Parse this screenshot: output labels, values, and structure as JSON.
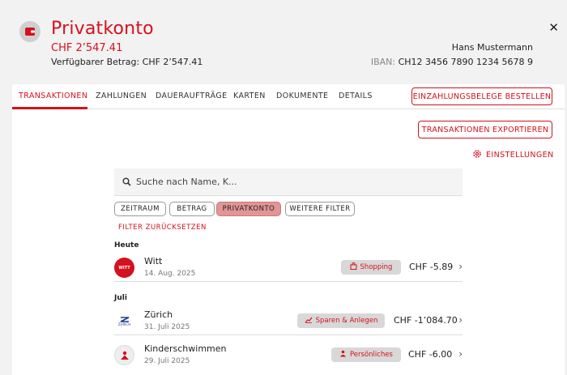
{
  "header": {
    "title": "Privatkonto",
    "balance": "CHF 2’547.41",
    "available": "Verfügbarer Betrag: CHF 2’547.41",
    "owner": "Hans Mustermann",
    "iban_label": "IBAN:",
    "iban_value": "CH12 3456 7890 1234 5678 9",
    "close_glyph": "✕"
  },
  "tabs": [
    {
      "label": "TRANSAKTIONEN",
      "active": true
    },
    {
      "label": "ZAHLUNGEN"
    },
    {
      "label": "DAUERAUFTRÄGE"
    },
    {
      "label": "KARTEN"
    },
    {
      "label": "DOKUMENTE"
    },
    {
      "label": "DETAILS"
    }
  ],
  "actions": {
    "order_slips": "EINZAHLUNGSBELEGE BESTELLEN",
    "export": "TRANSAKTIONEN EXPORTIEREN",
    "settings": "EINSTELLUNGEN"
  },
  "search": {
    "placeholder": "Suche nach Name, K..."
  },
  "filters": {
    "chips": [
      "ZEITRAUM",
      "BETRAG",
      "PRIVATKONTO",
      "WEITERE FILTER"
    ],
    "active": "PRIVATKONTO",
    "reset": "FILTER ZURÜCKSETZEN"
  },
  "groups": [
    {
      "label": "Heute",
      "items": [
        {
          "name": "Witt",
          "date": "14. Aug. 2025",
          "category": "Shopping",
          "amount": "CHF -5.89",
          "logo_text": "WITT",
          "category_icon": "shopping-bag-icon"
        }
      ]
    },
    {
      "label": "Juli",
      "items": [
        {
          "name": "Zürich",
          "date": "31. Juli 2025",
          "category": "Sparen & Anlegen",
          "amount": "CHF -1’084.70",
          "logo_text": "ZURICH",
          "category_icon": "chart-icon"
        },
        {
          "name": "Kinderschwimmen",
          "date": "29. Juli 2025",
          "category": "Persönliches",
          "amount": "CHF -6.00",
          "logo_text": "",
          "category_icon": "person-icon"
        }
      ]
    }
  ],
  "colors": {
    "accent": "#d5111d",
    "chip_active": "#e39595",
    "badge_bg": "#d8d8d8"
  }
}
